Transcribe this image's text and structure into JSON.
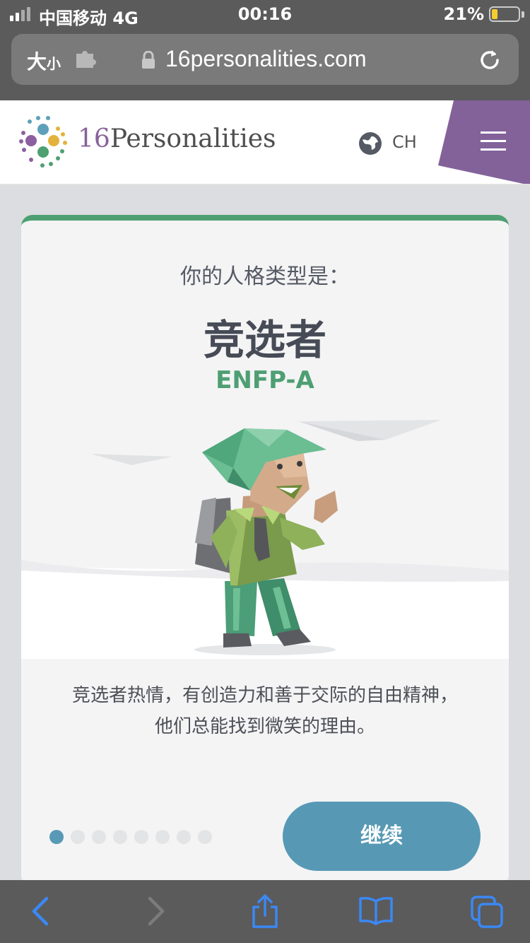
{
  "status_bar": {
    "carrier": "中国移动  4G",
    "time": "00:16",
    "battery_percent": "21%",
    "battery_level": 0.21
  },
  "browser": {
    "text_size_label_big": "大",
    "text_size_label_small": "小",
    "url": "16personalities.com"
  },
  "header": {
    "logo_number": "16",
    "logo_name": "Personalities",
    "language": "CH",
    "accent_color": "#88619a"
  },
  "card": {
    "subtitle": "你的人格类型是：",
    "type_name": "竞选者",
    "type_code": "ENFP-A",
    "description_line1": "竞选者热情，有创造力和善于交际的自由精神，",
    "description_line2": "他们总能找到微笑的理由。",
    "continue_label": "继续",
    "page_count": 8,
    "current_page": 1,
    "accent_green": "#4ea072",
    "button_color": "#5799b5"
  },
  "toolbar": {
    "icons": [
      "back-icon",
      "forward-icon",
      "share-icon",
      "bookmarks-icon",
      "tabs-icon"
    ]
  }
}
